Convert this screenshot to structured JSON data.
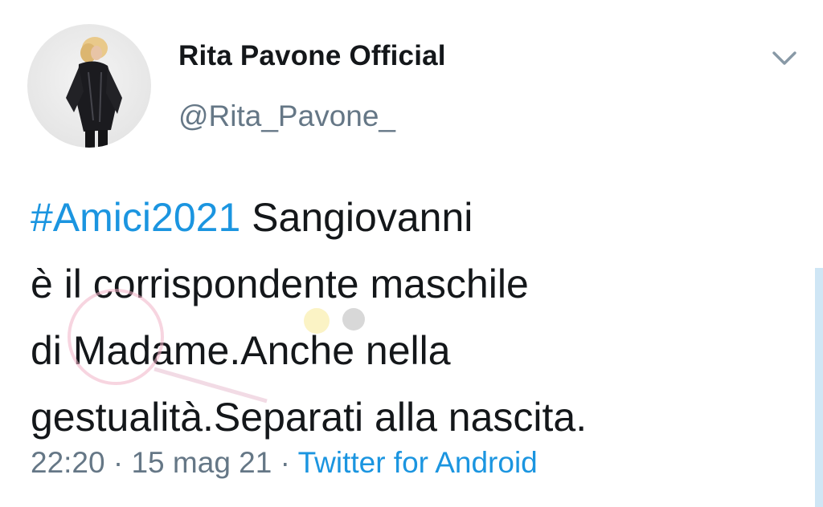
{
  "tweet": {
    "display_name": "Rita Pavone Official",
    "handle": "@Rita_Pavone_",
    "hashtag": "#Amici2021",
    "text_after_hashtag": " Sangiovanni\nè  il corrispondente maschile\ndi Madame.Anche nella\ngestualità.Separati alla nascita.",
    "time": "22:20",
    "separator_1": " · ",
    "date": "15 mag 21",
    "separator_2": " · ",
    "source": "Twitter for Android"
  },
  "icons": {
    "menu": "chevron-down-icon",
    "avatar": "avatar-photo"
  },
  "colors": {
    "text": "#14171a",
    "secondary": "#657786",
    "link": "#1b95e0"
  }
}
